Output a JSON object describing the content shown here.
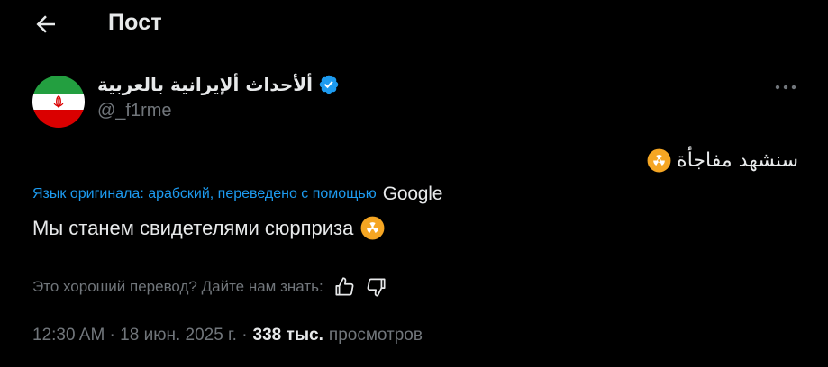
{
  "header": {
    "title": "Пост",
    "back_icon": "arrow-left-icon"
  },
  "author": {
    "display_name": "ألأحداث ألإيرانية بالعربية",
    "handle": "@_f1rme",
    "verified": true,
    "avatar": "iran-flag-avatar",
    "flag_colors": {
      "green": "#239f40",
      "white": "#ffffff",
      "red": "#da0000"
    }
  },
  "post": {
    "original_text": "سنشهد مفاجأة",
    "original_emoji": "radioactive-emoji",
    "translation_note": "Язык оригинала: арабский, переведено с помощью",
    "translation_provider": "Google",
    "translated_text": "Мы станем свидетелями сюрприза",
    "translated_emoji": "radioactive-emoji",
    "feedback_prompt": "Это хороший перевод? Дайте нам знать:",
    "time": "12:30 AM",
    "date": "18 июн. 2025 г.",
    "views_count": "338 тыс.",
    "views_label": "просмотров"
  },
  "colors": {
    "background": "#000000",
    "text_primary": "#e7e9ea",
    "text_secondary": "#71767b",
    "accent": "#1d9bf0",
    "emoji_orange": "#f5a623"
  }
}
